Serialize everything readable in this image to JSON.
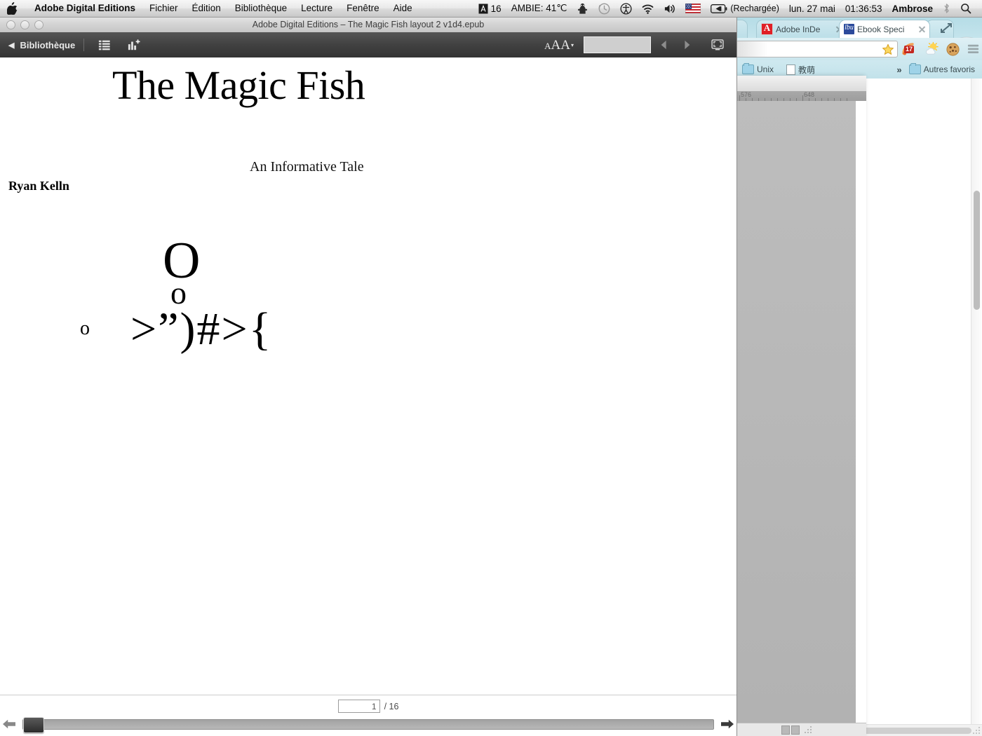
{
  "menubar": {
    "apple_icon": "apple-logo-icon",
    "app_name": "Adobe Digital Editions",
    "items": [
      "Fichier",
      "Édition",
      "Bibliothèque",
      "Lecture",
      "Fenêtre",
      "Aide"
    ],
    "right": {
      "app_badge": "16",
      "ambient": "AMBIE: 41℃",
      "icons": [
        "dropbox-icon",
        "time-machine-icon",
        "accessibility-icon",
        "wifi-icon",
        "volume-icon",
        "us-flag-icon",
        "battery-icon"
      ],
      "battery_status": "(Rechargée)",
      "date": "lun. 27 mai",
      "time": "01:36:53",
      "user": "Ambrose",
      "bluetooth_icon": "bluetooth-icon",
      "search_icon": "spotlight-search-icon"
    }
  },
  "ade": {
    "window_title": "Adobe Digital Editions – The Magic Fish layout 2 v1d4.epub",
    "traffic_lights": [
      "close",
      "minimize",
      "zoom"
    ],
    "toolbar": {
      "back_label": "Bibliothèque",
      "back_caret": "◀",
      "toc_icon": "table-of-contents-icon",
      "bookmark_icon": "add-bookmark-icon",
      "font_size_label": "AA",
      "font_size_caret": "▾",
      "search_value": "",
      "search_placeholder": "",
      "prev_icon": "previous-page-icon",
      "next_icon": "next-page-icon",
      "fullscreen_icon": "fullscreen-icon"
    },
    "content": {
      "title": "The Magic Fish",
      "subtitle": "An Informative Tale",
      "author": "Ryan Kelln",
      "ascii_art": {
        "bubble_large": "O",
        "bubble_small": "o",
        "bubble_tiny": "o",
        "fish_body": ">”)#>{"
      }
    },
    "footer": {
      "page_value": "1",
      "page_total": "/ 16",
      "prev_arrow_icon": "slider-previous-icon",
      "next_arrow_icon": "slider-next-icon"
    }
  },
  "chrome": {
    "tabs": [
      {
        "label": "Adobe InDe",
        "favicon": "adobe-indesign-favicon",
        "active": false
      },
      {
        "label": "Ebook Speci",
        "favicon": "ebook-spec-favicon",
        "active": true
      }
    ],
    "new_tab_icon": "new-tab-icon",
    "maximize_icon": "maximize-icon",
    "incognito_icon": "incognito-icon",
    "omnibox_value": "",
    "omnibox_placeholder": "",
    "star_icon": "bookmark-star-icon",
    "extensions": [
      {
        "name": "rss-reader-icon",
        "badge": "17"
      },
      {
        "name": "weather-icon",
        "badge": ""
      },
      {
        "name": "cookie-icon",
        "badge": ""
      }
    ],
    "menu_icon": "chrome-menu-icon",
    "bookmarks": [
      {
        "label": "Unix",
        "icon": "folder-icon"
      },
      {
        "label": "教萌",
        "icon": "page-icon"
      }
    ],
    "overflow_chevrons": "»",
    "other_bookmarks": "Autres favoris",
    "other_bookmarks_icon": "folder-icon"
  },
  "indesign": {
    "ruler_marks": [
      "576",
      "648"
    ]
  },
  "colors": {
    "chrome_tabstrip": "#bcdfe8",
    "ade_toolbar": "#414141",
    "menubar": "#e9e9e9",
    "badge_red": "#c3261f"
  }
}
